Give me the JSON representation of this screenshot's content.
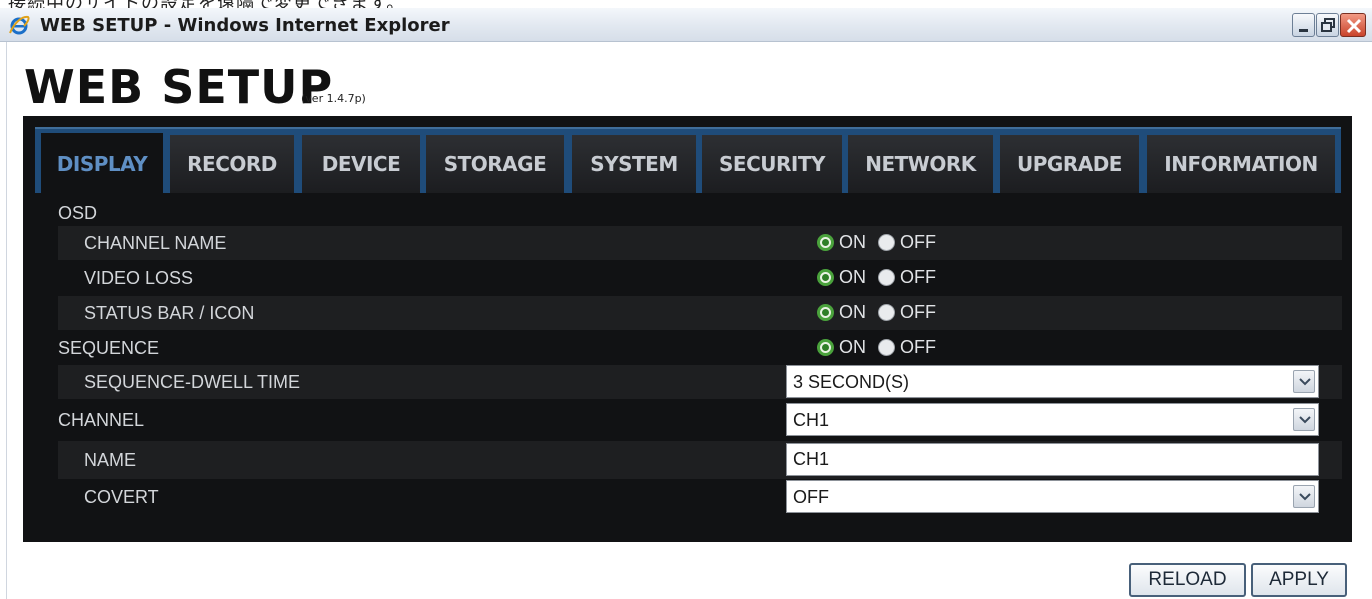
{
  "window": {
    "top_strip_text": "接続中のサイトの設定を遠隔で変更できます。",
    "title": "WEB SETUP - Windows Internet Explorer"
  },
  "header": {
    "title": "WEB SETUP",
    "version": "(ver 1.4.7p)"
  },
  "tabs": [
    {
      "label": "DISPLAY",
      "active": true
    },
    {
      "label": "RECORD",
      "active": false
    },
    {
      "label": "DEVICE",
      "active": false
    },
    {
      "label": "STORAGE",
      "active": false
    },
    {
      "label": "SYSTEM",
      "active": false
    },
    {
      "label": "SECURITY",
      "active": false
    },
    {
      "label": "NETWORK",
      "active": false
    },
    {
      "label": "UPGRADE",
      "active": false
    },
    {
      "label": "INFORMATION",
      "active": false
    }
  ],
  "settings": {
    "osd": {
      "label": "OSD"
    },
    "channel_name": {
      "label": "CHANNEL NAME",
      "on": "ON",
      "off": "OFF",
      "value": "ON"
    },
    "video_loss": {
      "label": "VIDEO LOSS",
      "on": "ON",
      "off": "OFF",
      "value": "ON"
    },
    "status_bar": {
      "label": "STATUS BAR / ICON",
      "on": "ON",
      "off": "OFF",
      "value": "ON"
    },
    "sequence": {
      "label": "SEQUENCE",
      "on": "ON",
      "off": "OFF",
      "value": "ON"
    },
    "dwell_time": {
      "label": "SEQUENCE-DWELL TIME",
      "value": "3 SECOND(S)"
    },
    "channel": {
      "label": "CHANNEL",
      "value": "CH1"
    },
    "name": {
      "label": "NAME",
      "value": "CH1"
    },
    "covert": {
      "label": "COVERT",
      "value": "OFF"
    }
  },
  "buttons": {
    "reload": "RELOAD",
    "apply": "APPLY"
  },
  "colors": {
    "panel_bg": "#111214",
    "tabbar_bg": "#1f4c7a",
    "active_tab_text": "#5f8fc4",
    "radio_checked": "#4aa23c"
  }
}
